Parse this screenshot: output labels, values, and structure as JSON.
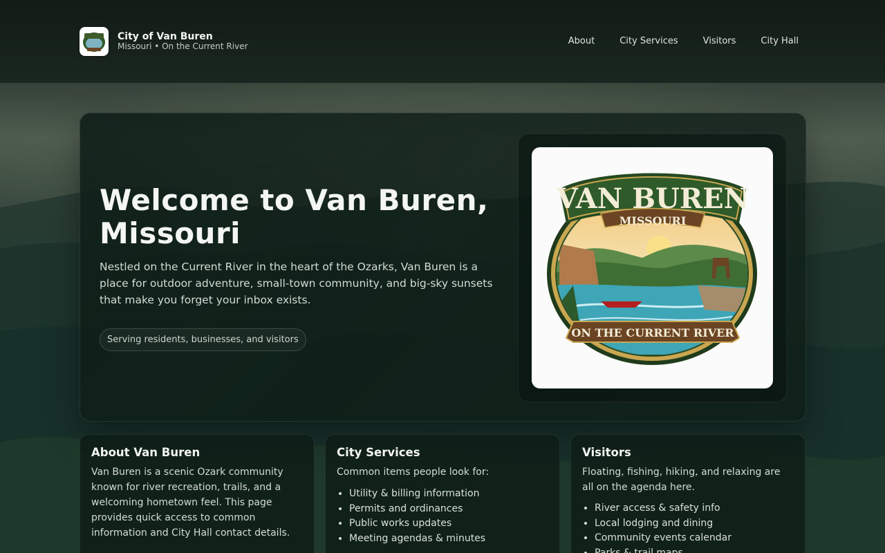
{
  "header": {
    "brand_title": "City of Van Buren",
    "brand_subtitle": "Missouri • On the Current River",
    "nav": [
      {
        "label": "About"
      },
      {
        "label": "City Services"
      },
      {
        "label": "Visitors"
      },
      {
        "label": "City Hall"
      }
    ]
  },
  "hero": {
    "title": "Welcome to Van Buren, Missouri",
    "description": "Nestled on the Current River in the heart of the Ozarks, Van Buren is a place for outdoor adventure, small-town community, and big-sky sunsets that make you forget your inbox exists.",
    "pill": "Serving residents, businesses, and visitors",
    "logo": {
      "top_text": "VAN BUREN",
      "state_text": "MISSOURI",
      "banner_text": "ON THE CURRENT RIVER"
    }
  },
  "cards": {
    "about": {
      "title": "About Van Buren",
      "body": "Van Buren is a scenic Ozark community known for river recreation, trails, and a welcoming hometown feel. This page provides quick access to common information and City Hall contact details."
    },
    "services": {
      "title": "City Services",
      "intro": "Common items people look for:",
      "items": [
        "Utility & billing information",
        "Permits and ordinances",
        "Public works updates",
        "Meeting agendas & minutes"
      ]
    },
    "visitors": {
      "title": "Visitors",
      "intro": "Floating, fishing, hiking, and relaxing are all on the agenda here.",
      "items": [
        "River access & safety info",
        "Local lodging and dining",
        "Community events calendar",
        "Parks & trail maps"
      ]
    }
  },
  "colors": {
    "page_background": "#17261f",
    "header_background": "#121c17",
    "panel": "#0e1e18",
    "text": "#e9efe9"
  }
}
